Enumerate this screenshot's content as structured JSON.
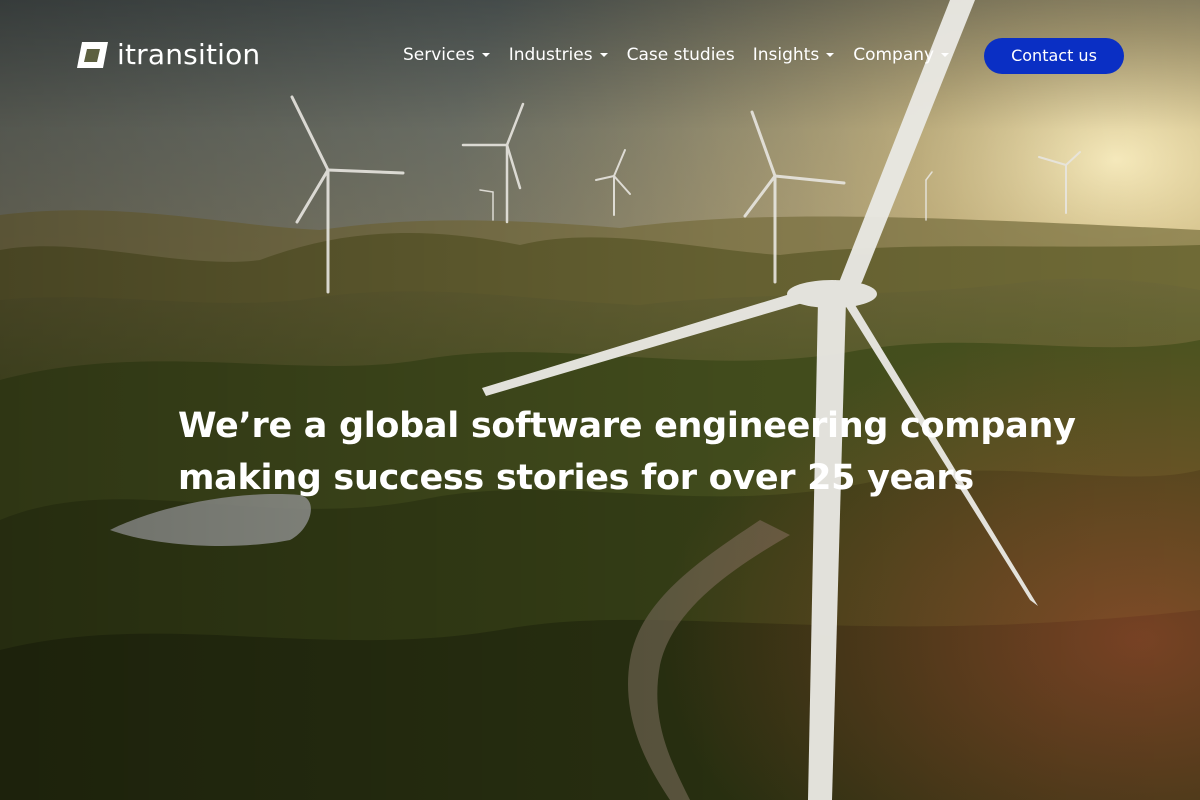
{
  "brand": {
    "name": "itransition",
    "logo_icon": "itransition-logo-icon"
  },
  "nav": {
    "items": [
      {
        "label": "Services",
        "has_dropdown": true
      },
      {
        "label": "Industries",
        "has_dropdown": true
      },
      {
        "label": "Case studies",
        "has_dropdown": false
      },
      {
        "label": "Insights",
        "has_dropdown": true
      },
      {
        "label": "Company",
        "has_dropdown": true
      }
    ],
    "contact_label": "Contact us"
  },
  "hero": {
    "headline_line1": "We’re a global software engineering company",
    "headline_line2": "making success stories for over 25 years",
    "background": "wind-turbines-on-hills-at-sunset"
  },
  "colors": {
    "accent": "#0a2fc4",
    "text": "#ffffff"
  }
}
